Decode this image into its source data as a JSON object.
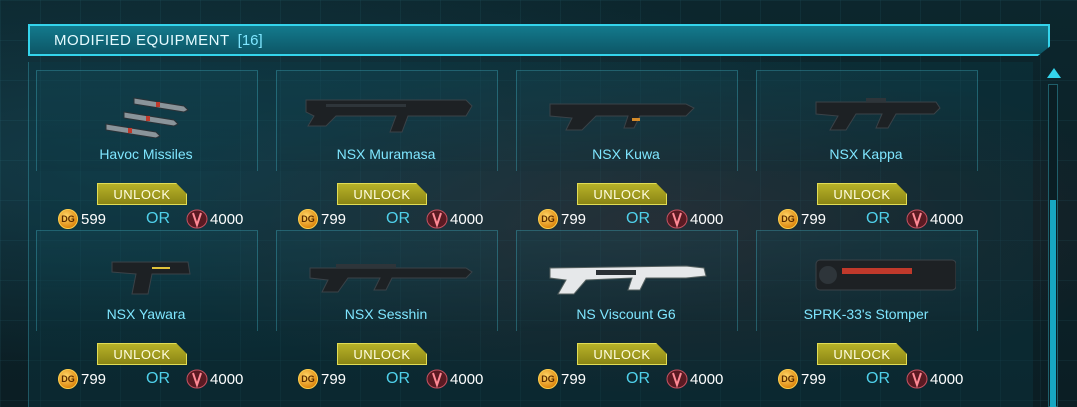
{
  "header": {
    "title": "MODIFIED EQUIPMENT",
    "count": "[16]"
  },
  "currency_icon": "dg-coin-icon",
  "alt_currency_icon": "certification-icon",
  "or_label": "OR",
  "unlock_label": "UNLOCK",
  "colors": {
    "accent": "#34d4ec",
    "unlock": "#b8b228",
    "name": "#7fe6ff"
  },
  "items": [
    {
      "name": "Havoc Missiles",
      "price_dg": "599",
      "price_cert": "4000"
    },
    {
      "name": "NSX Muramasa",
      "price_dg": "799",
      "price_cert": "4000"
    },
    {
      "name": "NSX Kuwa",
      "price_dg": "799",
      "price_cert": "4000"
    },
    {
      "name": "NSX Kappa",
      "price_dg": "799",
      "price_cert": "4000"
    },
    {
      "name": "NSX Yawara",
      "price_dg": "799",
      "price_cert": "4000"
    },
    {
      "name": "NSX Sesshin",
      "price_dg": "799",
      "price_cert": "4000"
    },
    {
      "name": "NS Viscount G6",
      "price_dg": "799",
      "price_cert": "4000"
    },
    {
      "name": "SPRK-33's Stomper",
      "price_dg": "799",
      "price_cert": "4000"
    }
  ]
}
